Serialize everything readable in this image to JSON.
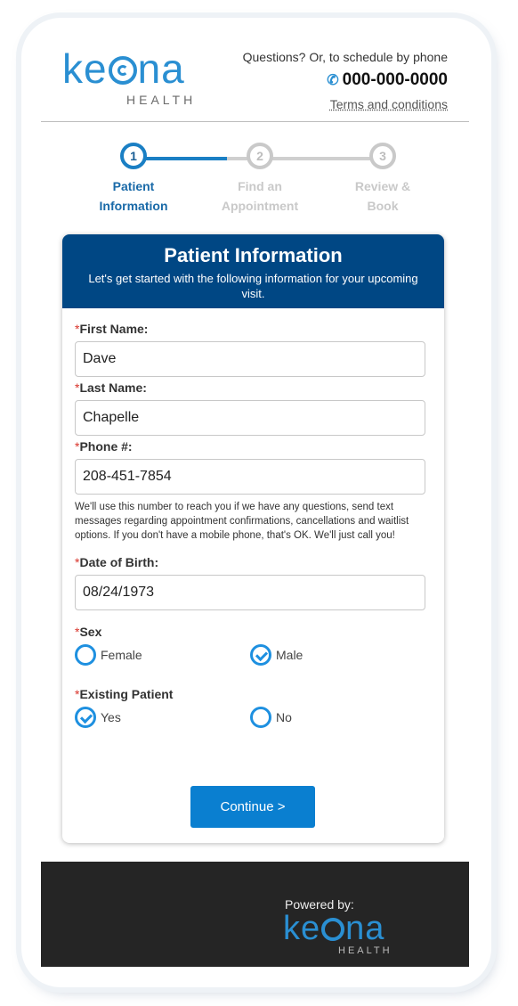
{
  "header": {
    "logo_text": "keona",
    "logo_sub": "HEALTH",
    "question": "Questions? Or, to schedule by phone",
    "phone": "000-000-0000",
    "phone_icon": "phone-icon",
    "terms": "Terms and conditions"
  },
  "stepper": {
    "steps": [
      {
        "num": "1",
        "line1": "Patient",
        "line2": "Information",
        "active": true
      },
      {
        "num": "2",
        "line1": "Find an",
        "line2": "Appointment",
        "active": false
      },
      {
        "num": "3",
        "line1": "Review &",
        "line2": "Book",
        "active": false
      }
    ]
  },
  "card": {
    "title": "Patient Information",
    "subtitle": "Let's get started with the following information for your upcoming visit."
  },
  "form": {
    "required_mark": "*",
    "first_name_label": "First Name:",
    "first_name_value": "Dave",
    "last_name_label": "Last Name:",
    "last_name_value": "Chapelle",
    "phone_label": "Phone #:",
    "phone_value": "208-451-7854",
    "phone_help": "We'll use this number to reach you if we have any questions, send text messages regarding appointment confirmations, cancellations and waitlist options. If you don't have a mobile phone, that's OK. We'll just call you!",
    "dob_label": "Date of Birth:",
    "dob_value": "08/24/1973",
    "sex_label": "Sex",
    "sex_options": [
      {
        "label": "Female",
        "checked": false
      },
      {
        "label": "Male",
        "checked": true
      }
    ],
    "existing_label": "Existing Patient",
    "existing_options": [
      {
        "label": "Yes",
        "checked": true
      },
      {
        "label": "No",
        "checked": false
      }
    ],
    "continue_label": "Continue >"
  },
  "footer": {
    "powered_by": "Powered by:",
    "logo_text": "keona",
    "logo_sub": "HEALTH"
  },
  "colors": {
    "brand_blue": "#2a8fd2",
    "header_navy": "#004784",
    "button_blue": "#0a7fd0",
    "required_red": "#d9342b",
    "footer_dark": "#252525"
  }
}
